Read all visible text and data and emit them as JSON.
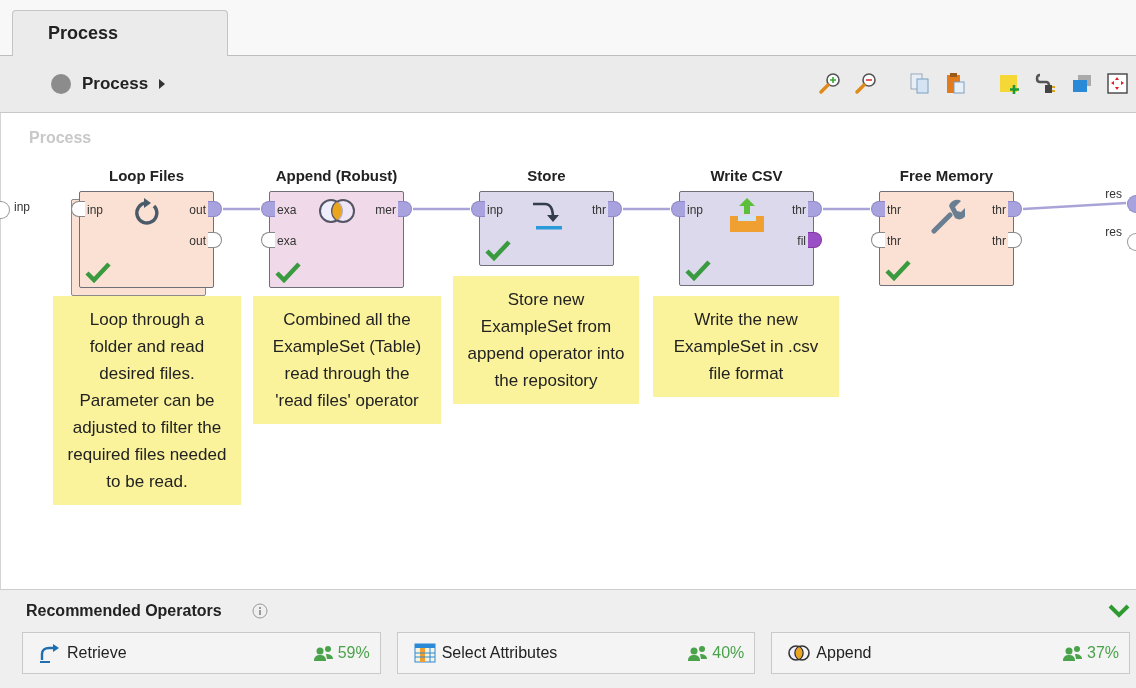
{
  "tabs": [
    {
      "label": "Process",
      "selected": true
    }
  ],
  "breadcrumb": {
    "label": "Process"
  },
  "canvas": {
    "title": "Process",
    "process_inputs": [
      {
        "label": "inp",
        "connected": false
      }
    ],
    "process_outputs": [
      {
        "label": "res",
        "connected": true
      },
      {
        "label": "res",
        "connected": false
      }
    ],
    "operators": [
      {
        "name": "Loop Files",
        "kind": "loop",
        "color": "#fbe1d4",
        "nested": true,
        "ok": true,
        "inputs": [
          {
            "label": "inp",
            "connected": false
          }
        ],
        "outputs": [
          {
            "label": "out",
            "connected": true
          },
          {
            "label": "out",
            "connected": false
          }
        ],
        "note": "Loop through a folder and read desired files. Parameter can be adjusted to filter the required files needed to be read."
      },
      {
        "name": "Append (Robust)",
        "kind": "append",
        "color": "#f0d9e8",
        "ok": true,
        "inputs": [
          {
            "label": "exa",
            "connected": true
          },
          {
            "label": "exa",
            "connected": false
          }
        ],
        "outputs": [
          {
            "label": "mer",
            "connected": true
          }
        ],
        "note": "Combined all the ExampleSet (Table) read through the 'read files' operator"
      },
      {
        "name": "Store",
        "kind": "store",
        "color": "#dcd9ec",
        "ok": true,
        "inputs": [
          {
            "label": "inp",
            "connected": true
          }
        ],
        "outputs": [
          {
            "label": "thr",
            "connected": true
          }
        ],
        "note": "Store new ExampleSet from append operator into the repository"
      },
      {
        "name": "Write CSV",
        "kind": "write",
        "color": "#dcd9ec",
        "ok": true,
        "inputs": [
          {
            "label": "inp",
            "connected": true
          }
        ],
        "outputs": [
          {
            "label": "thr",
            "connected": true
          },
          {
            "label": "fil",
            "connected": true,
            "kind": "file"
          }
        ],
        "note": "Write the new ExampleSet in .csv file format"
      },
      {
        "name": "Free Memory",
        "kind": "wrench",
        "color": "#fbe1d4",
        "ok": true,
        "inputs": [
          {
            "label": "thr",
            "connected": true
          },
          {
            "label": "thr",
            "connected": false
          }
        ],
        "outputs": [
          {
            "label": "thr",
            "connected": true
          },
          {
            "label": "thr",
            "connected": false
          }
        ]
      }
    ]
  },
  "recommended": {
    "title": "Recommended Operators",
    "expanded": true,
    "items": [
      {
        "label": "Retrieve",
        "kind": "retrieve",
        "share": "59%"
      },
      {
        "label": "Select Attributes",
        "kind": "table",
        "share": "40%"
      },
      {
        "label": "Append",
        "kind": "append",
        "share": "37%"
      }
    ]
  }
}
